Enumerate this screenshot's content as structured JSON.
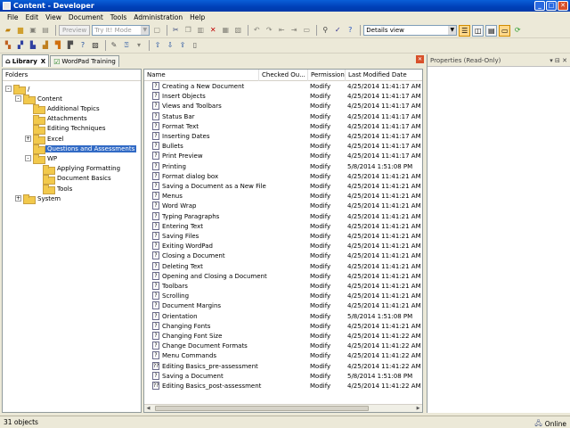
{
  "window": {
    "title": "Content - Developer"
  },
  "menu": [
    "File",
    "Edit",
    "View",
    "Document",
    "Tools",
    "Administration",
    "Help"
  ],
  "toolbar": {
    "preview_label": "Preview",
    "mode_value": "Try It! Mode",
    "view_value": "Details view"
  },
  "tabs": [
    {
      "label": "Library",
      "close": "X"
    },
    {
      "label": "WordPad Training"
    }
  ],
  "folders": {
    "header": "Folders",
    "nodes": [
      {
        "label": "/",
        "depth": 0,
        "toggle": "-",
        "selected": false
      },
      {
        "label": "Content",
        "depth": 1,
        "toggle": "-",
        "selected": false
      },
      {
        "label": "Additional Topics",
        "depth": 2,
        "toggle": "",
        "selected": false
      },
      {
        "label": "Attachments",
        "depth": 2,
        "toggle": "",
        "selected": false
      },
      {
        "label": "Editing Techniques",
        "depth": 2,
        "toggle": "",
        "selected": false
      },
      {
        "label": "Excel",
        "depth": 2,
        "toggle": "+",
        "selected": false
      },
      {
        "label": "Questions and Assessments",
        "depth": 2,
        "toggle": "",
        "selected": true
      },
      {
        "label": "WP",
        "depth": 2,
        "toggle": "-",
        "selected": false
      },
      {
        "label": "Applying Formatting",
        "depth": 3,
        "toggle": "",
        "selected": false
      },
      {
        "label": "Document Basics",
        "depth": 3,
        "toggle": "",
        "selected": false
      },
      {
        "label": "Tools",
        "depth": 3,
        "toggle": "",
        "selected": false
      },
      {
        "label": "System",
        "depth": 1,
        "toggle": "+",
        "selected": false
      }
    ]
  },
  "files": {
    "columns": {
      "name": "Name",
      "checked_out": "Checked Ou...",
      "permission": "Permission",
      "modified": "Last Modified Date"
    },
    "rows": [
      {
        "name": "Creating a New Document",
        "permission": "Modify",
        "modified": "4/25/2014 11:41:17 AM",
        "icon": "?"
      },
      {
        "name": "Insert Objects",
        "permission": "Modify",
        "modified": "4/25/2014 11:41:17 AM",
        "icon": "?"
      },
      {
        "name": "Views and Toolbars",
        "permission": "Modify",
        "modified": "4/25/2014 11:41:17 AM",
        "icon": "?"
      },
      {
        "name": "Status Bar",
        "permission": "Modify",
        "modified": "4/25/2014 11:41:17 AM",
        "icon": "?"
      },
      {
        "name": "Format Text",
        "permission": "Modify",
        "modified": "4/25/2014 11:41:17 AM",
        "icon": "?"
      },
      {
        "name": "Inserting Dates",
        "permission": "Modify",
        "modified": "4/25/2014 11:41:17 AM",
        "icon": "?"
      },
      {
        "name": "Bullets",
        "permission": "Modify",
        "modified": "4/25/2014 11:41:17 AM",
        "icon": "?"
      },
      {
        "name": "Print Preview",
        "permission": "Modify",
        "modified": "4/25/2014 11:41:17 AM",
        "icon": "?"
      },
      {
        "name": "Printing",
        "permission": "Modify",
        "modified": "5/8/2014 1:51:08 PM",
        "icon": "?"
      },
      {
        "name": "Format dialog box",
        "permission": "Modify",
        "modified": "4/25/2014 11:41:21 AM",
        "icon": "?"
      },
      {
        "name": "Saving a Document as a New File",
        "permission": "Modify",
        "modified": "4/25/2014 11:41:21 AM",
        "icon": "?"
      },
      {
        "name": "Menus",
        "permission": "Modify",
        "modified": "4/25/2014 11:41:21 AM",
        "icon": "?"
      },
      {
        "name": "Word Wrap",
        "permission": "Modify",
        "modified": "4/25/2014 11:41:21 AM",
        "icon": "?"
      },
      {
        "name": "Typing Paragraphs",
        "permission": "Modify",
        "modified": "4/25/2014 11:41:21 AM",
        "icon": "?"
      },
      {
        "name": "Entering Text",
        "permission": "Modify",
        "modified": "4/25/2014 11:41:21 AM",
        "icon": "?"
      },
      {
        "name": "Saving Files",
        "permission": "Modify",
        "modified": "4/25/2014 11:41:21 AM",
        "icon": "?"
      },
      {
        "name": "Exiting WordPad",
        "permission": "Modify",
        "modified": "4/25/2014 11:41:21 AM",
        "icon": "?"
      },
      {
        "name": "Closing a Document",
        "permission": "Modify",
        "modified": "4/25/2014 11:41:21 AM",
        "icon": "?"
      },
      {
        "name": "Deleting Text",
        "permission": "Modify",
        "modified": "4/25/2014 11:41:21 AM",
        "icon": "?"
      },
      {
        "name": "Opening and Closing a Document",
        "permission": "Modify",
        "modified": "4/25/2014 11:41:21 AM",
        "icon": "?"
      },
      {
        "name": "Toolbars",
        "permission": "Modify",
        "modified": "4/25/2014 11:41:21 AM",
        "icon": "?"
      },
      {
        "name": "Scrolling",
        "permission": "Modify",
        "modified": "4/25/2014 11:41:21 AM",
        "icon": "?"
      },
      {
        "name": "Document Margins",
        "permission": "Modify",
        "modified": "4/25/2014 11:41:21 AM",
        "icon": "?"
      },
      {
        "name": "Orientation",
        "permission": "Modify",
        "modified": "5/8/2014 1:51:08 PM",
        "icon": "?"
      },
      {
        "name": "Changing Fonts",
        "permission": "Modify",
        "modified": "4/25/2014 11:41:21 AM",
        "icon": "?"
      },
      {
        "name": "Changing Font Size",
        "permission": "Modify",
        "modified": "4/25/2014 11:41:22 AM",
        "icon": "?"
      },
      {
        "name": "Change Document Formats",
        "permission": "Modify",
        "modified": "4/25/2014 11:41:22 AM",
        "icon": "?"
      },
      {
        "name": "Menu Commands",
        "permission": "Modify",
        "modified": "4/25/2014 11:41:22 AM",
        "icon": "?"
      },
      {
        "name": "Editing Basics_pre-assessment",
        "permission": "Modify",
        "modified": "4/25/2014 11:41:22 AM",
        "icon": "??"
      },
      {
        "name": "Saving a Document",
        "permission": "Modify",
        "modified": "5/8/2014 1:51:08 PM",
        "icon": "?"
      },
      {
        "name": "Editing Basics_post-assessment",
        "permission": "Modify",
        "modified": "4/25/2014 11:41:22 AM",
        "icon": "??"
      }
    ]
  },
  "properties": {
    "title": "Properties (Read-Only)"
  },
  "status": {
    "count": "31 objects",
    "online": "Online"
  }
}
